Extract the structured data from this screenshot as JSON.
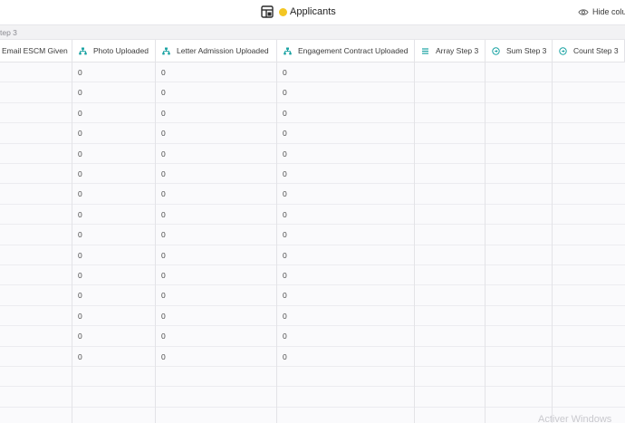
{
  "topbar": {
    "table_icon": "table-icon",
    "dot_color": "#f3c623",
    "title": "Applicants",
    "hide_icon": "eye-icon",
    "hide_label": "Hide colu"
  },
  "tabbar": {
    "label": "tep 3"
  },
  "columns": [
    {
      "label": "Email ESCM Given",
      "icon": ""
    },
    {
      "label": "Photo Uploaded",
      "icon": "lookup-icon"
    },
    {
      "label": "Letter Admission Uploaded",
      "icon": "lookup-icon"
    },
    {
      "label": "Engagement Contract Uploaded",
      "icon": "lookup-icon"
    },
    {
      "label": "Array Step 3",
      "icon": "list-icon"
    },
    {
      "label": "Sum Step 3",
      "icon": "rollup-icon"
    },
    {
      "label": "Count Step 3",
      "icon": "rollup-icon"
    }
  ],
  "rows": [
    [
      "",
      "0",
      "0",
      "0",
      "",
      "",
      ""
    ],
    [
      "",
      "0",
      "0",
      "0",
      "",
      "",
      ""
    ],
    [
      "",
      "0",
      "0",
      "0",
      "",
      "",
      ""
    ],
    [
      "",
      "0",
      "0",
      "0",
      "",
      "",
      ""
    ],
    [
      "",
      "0",
      "0",
      "0",
      "",
      "",
      ""
    ],
    [
      "",
      "0",
      "0",
      "0",
      "",
      "",
      ""
    ],
    [
      "",
      "0",
      "0",
      "0",
      "",
      "",
      ""
    ],
    [
      "",
      "0",
      "0",
      "0",
      "",
      "",
      ""
    ],
    [
      "",
      "0",
      "0",
      "0",
      "",
      "",
      ""
    ],
    [
      "",
      "0",
      "0",
      "0",
      "",
      "",
      ""
    ],
    [
      "",
      "0",
      "0",
      "0",
      "",
      "",
      ""
    ],
    [
      "",
      "0",
      "0",
      "0",
      "",
      "",
      ""
    ],
    [
      "",
      "0",
      "0",
      "0",
      "",
      "",
      ""
    ],
    [
      "",
      "0",
      "0",
      "0",
      "",
      "",
      ""
    ],
    [
      "",
      "0",
      "0",
      "0",
      "",
      "",
      ""
    ],
    [
      "",
      "",
      "",
      "",
      "",
      "",
      ""
    ],
    [
      "",
      "",
      "",
      "",
      "",
      "",
      ""
    ],
    [
      "",
      "",
      "",
      "",
      "",
      "",
      ""
    ]
  ],
  "watermark": "Activer Windows",
  "colors": {
    "accent_teal": "#1aa3a3",
    "grid": "#e3e3e7",
    "row_bg": "#fafafc"
  }
}
